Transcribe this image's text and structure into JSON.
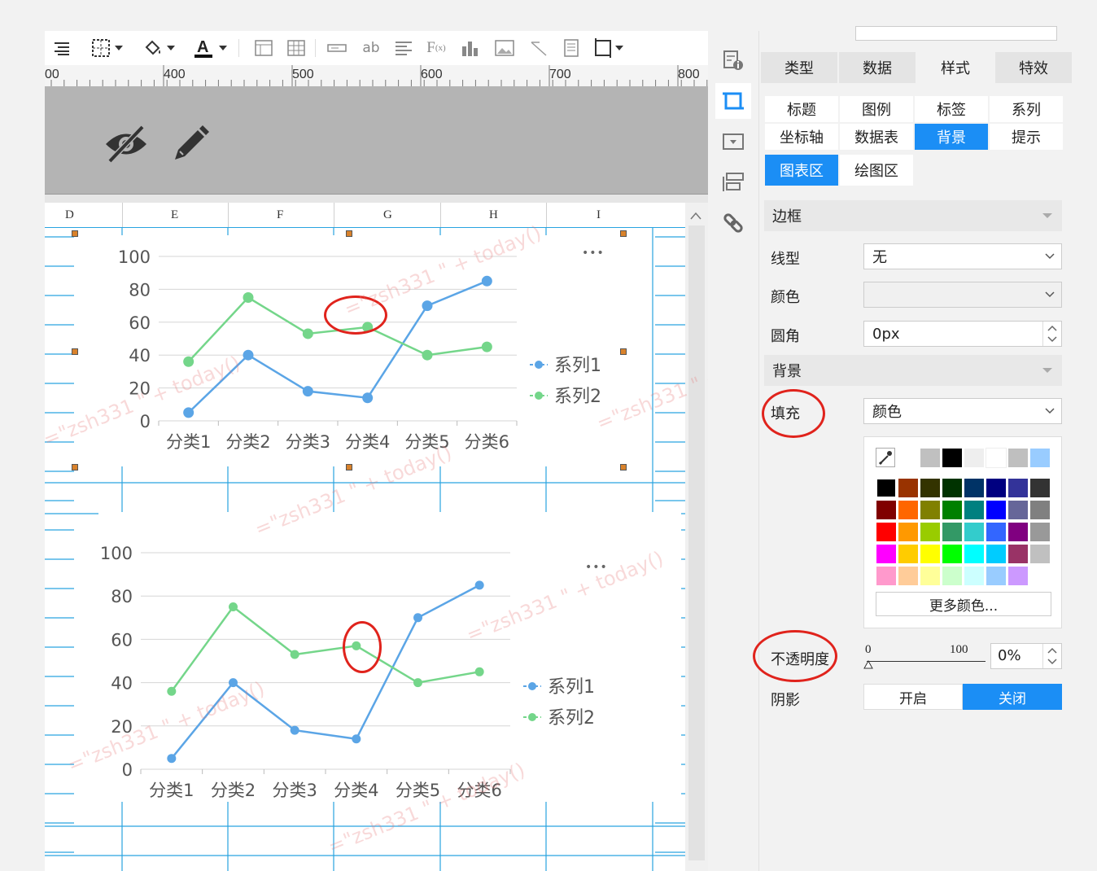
{
  "ruler": {
    "ticks": [
      "00",
      "400",
      "500",
      "600",
      "700",
      "800"
    ]
  },
  "columns": [
    "D",
    "E",
    "F",
    "G",
    "H",
    "I"
  ],
  "charts": [
    {
      "more_label": "•••"
    },
    {
      "more_label": "•••"
    }
  ],
  "chart_data": [
    {
      "type": "line",
      "categories": [
        "分类1",
        "分类2",
        "分类3",
        "分类4",
        "分类5",
        "分类6"
      ],
      "series": [
        {
          "name": "系列1",
          "values": [
            5,
            40,
            18,
            14,
            70,
            85
          ]
        },
        {
          "name": "系列2",
          "values": [
            36,
            75,
            53,
            57,
            40,
            45
          ]
        }
      ],
      "ylim": [
        0,
        100
      ],
      "yticks": [
        "100",
        "80",
        "60",
        "40",
        "20",
        "0"
      ],
      "grid": true,
      "legend": "right",
      "colors": [
        "#5ba5e6",
        "#74d68a"
      ]
    },
    {
      "type": "line",
      "categories": [
        "分类1",
        "分类2",
        "分类3",
        "分类4",
        "分类5",
        "分类6"
      ],
      "series": [
        {
          "name": "系列1",
          "values": [
            5,
            40,
            18,
            14,
            70,
            85
          ]
        },
        {
          "name": "系列2",
          "values": [
            36,
            75,
            53,
            57,
            40,
            45
          ]
        }
      ],
      "ylim": [
        0,
        100
      ],
      "yticks": [
        "100",
        "80",
        "60",
        "40",
        "20",
        "0"
      ],
      "grid": true,
      "legend": "right",
      "colors": [
        "#5ba5e6",
        "#74d68a"
      ]
    }
  ],
  "watermark": "=\"zsh331 \" + today()",
  "panel": {
    "main_tabs": [
      "类型",
      "数据",
      "样式",
      "特效"
    ],
    "sub_tabs": [
      "标题",
      "图例",
      "标签",
      "系列",
      "坐标轴",
      "数据表",
      "背景",
      "提示"
    ],
    "area_tabs": [
      "图表区",
      "绘图区"
    ],
    "border_section": "边框",
    "line_type_label": "线型",
    "line_type_value": "无",
    "color_label": "颜色",
    "radius_label": "圆角",
    "radius_value": "0px",
    "bg_section": "背景",
    "fill_label": "填充",
    "fill_value": "颜色",
    "more_colors": "更多颜色...",
    "opacity_label": "不透明度",
    "slider_min": "0",
    "slider_max": "100",
    "opacity_value": "0%",
    "shadow_label": "阴影",
    "shadow_on": "开启",
    "shadow_off": "关闭",
    "palette_recent": [
      "#c0c0c0",
      "#000000",
      "#eeeeee",
      "#ffffff",
      "#bfbfbf",
      "#99ccff"
    ],
    "palette": [
      [
        "#000000",
        "#993300",
        "#333300",
        "#003300",
        "#003366",
        "#000080",
        "#333399",
        "#333333"
      ],
      [
        "#800000",
        "#ff6600",
        "#808000",
        "#008000",
        "#008080",
        "#0000ff",
        "#666699",
        "#808080"
      ],
      [
        "#ff0000",
        "#ff9900",
        "#99cc00",
        "#339966",
        "#33cccc",
        "#3366ff",
        "#800080",
        "#999999"
      ],
      [
        "#ff00ff",
        "#ffcc00",
        "#ffff00",
        "#00ff00",
        "#00ffff",
        "#00ccff",
        "#993366",
        "#c0c0c0"
      ],
      [
        "#ff99cc",
        "#ffcc99",
        "#ffff99",
        "#ccffcc",
        "#ccffff",
        "#99ccff",
        "#cc99ff",
        "#ffffff"
      ]
    ]
  }
}
